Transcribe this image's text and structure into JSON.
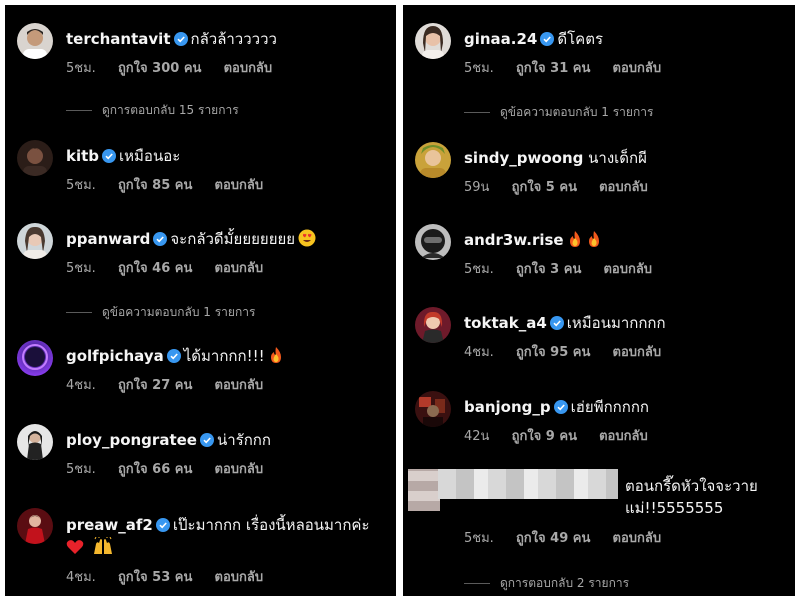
{
  "colors": {
    "background": "#000000",
    "text": "#f5f5f5",
    "muted": "#a8a8a8",
    "verified": "#3897f0"
  },
  "left_panel": {
    "comments": [
      {
        "username": "terchantavit",
        "verified": true,
        "text": "กลัวล้าววววว",
        "time": "5ชม.",
        "likes": "ถูกใจ 300 คน",
        "reply": "ตอบกลับ",
        "replies_link": "ดูการตอบกลับ 15 รายการ"
      },
      {
        "username": "kitb",
        "verified": true,
        "text": "เหมือนอะ",
        "time": "5ชม.",
        "likes": "ถูกใจ 85 คน",
        "reply": "ตอบกลับ"
      },
      {
        "username": "ppanward",
        "verified": true,
        "text": "จะกลัวดีมั้ยยยยยยย",
        "emoji": "smiling-face-with-heart-eyes",
        "time": "5ชม.",
        "likes": "ถูกใจ 46 คน",
        "reply": "ตอบกลับ",
        "replies_link": "ดูข้อความตอบกลับ 1 รายการ"
      },
      {
        "username": "golfpichaya",
        "verified": true,
        "text": "ได้มากกก!!!",
        "emoji": "fire",
        "time": "4ชม.",
        "likes": "ถูกใจ 27 คน",
        "reply": "ตอบกลับ"
      },
      {
        "username": "ploy_pongratee",
        "verified": true,
        "text": "น่ารักกก",
        "time": "5ชม.",
        "likes": "ถูกใจ 66 คน",
        "reply": "ตอบกลับ"
      },
      {
        "username": "preaw_af2",
        "verified": true,
        "text": "เป๊ะมากกก เรื่องนี้หลอนมากค่ะ",
        "emoji": "red-heart, raising-hands",
        "time": "4ชม.",
        "likes": "ถูกใจ 53 คน",
        "reply": "ตอบกลับ"
      }
    ]
  },
  "right_panel": {
    "comments": [
      {
        "username": "ginaa.24",
        "verified": true,
        "text": "ดีโคตร",
        "time": "5ชม.",
        "likes": "ถูกใจ 31 คน",
        "reply": "ตอบกลับ",
        "replies_link": "ดูข้อความตอบกลับ 1 รายการ"
      },
      {
        "username": "sindy_pwoong",
        "verified": false,
        "text": "นางเด็กผี",
        "time": "59น",
        "likes": "ถูกใจ 5 คน",
        "reply": "ตอบกลับ"
      },
      {
        "username": "andr3w.rise",
        "verified": false,
        "text": "",
        "emoji": "fire, fire",
        "time": "5ชม.",
        "likes": "ถูกใจ 3 คน",
        "reply": "ตอบกลับ"
      },
      {
        "username": "toktak_a4",
        "verified": true,
        "text": "เหมือนมากกกก",
        "time": "4ชม.",
        "likes": "ถูกใจ 95 คน",
        "reply": "ตอบกลับ"
      },
      {
        "username": "banjong_p",
        "verified": true,
        "text": "เฮ่ยพีกกกกก",
        "time": "42น",
        "likes": "ถูกใจ 9 คน",
        "reply": "ตอบกลับ"
      },
      {
        "username": "",
        "verified": false,
        "text": "ตอนกรี๊ดหัวใจจะวาย แม่!!5555555",
        "time": "5ชม.",
        "likes": "ถูกใจ 49 คน",
        "reply": "ตอบกลับ",
        "replies_link": "ดูการตอบกลับ 2 รายการ"
      }
    ]
  }
}
